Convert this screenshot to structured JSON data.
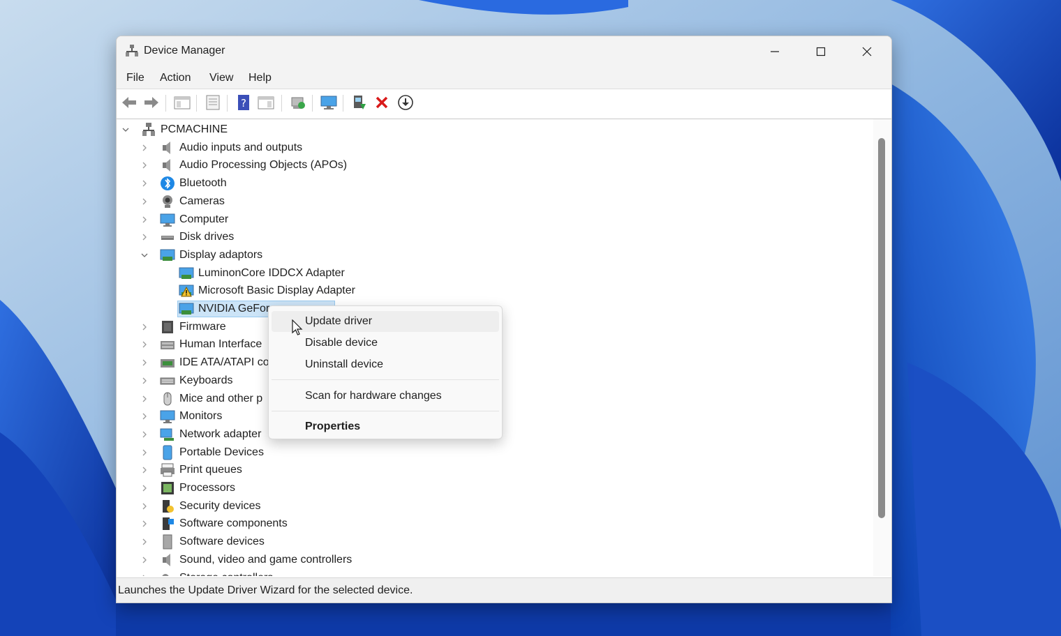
{
  "window": {
    "title": "Device Manager"
  },
  "menubar": {
    "items": [
      "File",
      "Action",
      "View",
      "Help"
    ]
  },
  "toolbar": {
    "buttons": [
      "back-arrow-icon",
      "forward-arrow-icon",
      "show-hide-console-tree-icon",
      "properties-icon",
      "help-icon",
      "action-pane-icon",
      "scan-hardware-icon",
      "monitor-icon",
      "update-driver-icon",
      "uninstall-x-icon",
      "download-icon"
    ]
  },
  "tree": {
    "root": "PCMACHINE",
    "categories": [
      "Audio inputs and outputs",
      "Audio Processing Objects (APOs)",
      "Bluetooth",
      "Cameras",
      "Computer",
      "Disk drives",
      "Display adaptors",
      "Firmware",
      "Human Interface",
      "IDE ATA/ATAPI cor",
      "Keyboards",
      "Mice and other p",
      "Monitors",
      "Network adapter",
      "Portable Devices",
      "Print queues",
      "Processors",
      "Security devices",
      "Software components",
      "Software devices",
      "Sound, video and game controllers",
      "Storage controllers"
    ],
    "display_children": [
      "LuminonCore IDDCX Adapter",
      "Microsoft Basic Display Adapter",
      "NVIDIA GeFor"
    ]
  },
  "context_menu": {
    "items": [
      "Update driver",
      "Disable device",
      "Uninstall device",
      "Scan for hardware changes",
      "Properties"
    ]
  },
  "statusbar": {
    "text": "Launches the Update Driver Wizard for the selected device."
  }
}
